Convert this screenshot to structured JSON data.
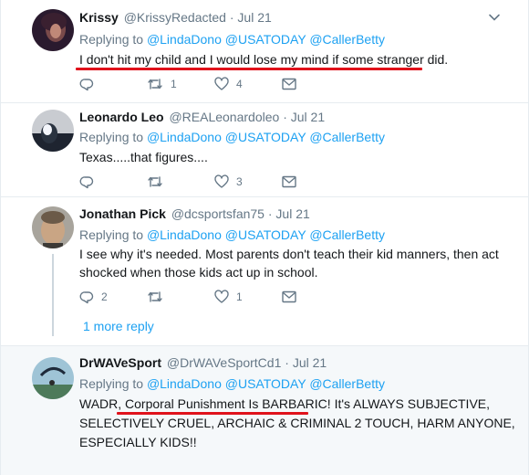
{
  "tweets": [
    {
      "name": "Krissy",
      "handle": "@KrissyRedacted",
      "dot": "·",
      "time": "Jul 21",
      "replying_prefix": "Replying to",
      "mentions": [
        "@LindaDono",
        "@USATODAY",
        "@CallerBetty"
      ],
      "text_lines": [
        "I don't hit my child and I would lose my mind if some stranger did."
      ],
      "replies": "",
      "retweets": "1",
      "likes": "4"
    },
    {
      "name": "Leonardo Leo",
      "handle": "@REALeonardoleo",
      "dot": "·",
      "time": "Jul 21",
      "replying_prefix": "Replying to",
      "mentions": [
        "@LindaDono",
        "@USATODAY",
        "@CallerBetty"
      ],
      "text_lines": [
        "Texas.....that figures...."
      ],
      "replies": "",
      "retweets": "",
      "likes": "3"
    },
    {
      "name": "Jonathan Pick",
      "handle": "@dcsportsfan75",
      "dot": "·",
      "time": "Jul 21",
      "replying_prefix": "Replying to",
      "mentions": [
        "@LindaDono",
        "@USATODAY",
        "@CallerBetty"
      ],
      "text_lines": [
        "I see why it's needed. Most parents don't teach their kid manners, then act",
        "shocked when those kids act up in school."
      ],
      "replies": "2",
      "retweets": "",
      "likes": "1",
      "more_replies": "1 more reply"
    },
    {
      "name": "DrWAVeSport",
      "handle": "@DrWAVeSportCd1",
      "dot": "·",
      "time": "Jul 21",
      "replying_prefix": "Replying to",
      "mentions": [
        "@LindaDono",
        "@USATODAY",
        "@CallerBetty"
      ],
      "text_lines": [
        "WADR, Corporal Punishment Is BARBARIC! It's ALWAYS SUBJECTIVE,",
        "SELECTIVELY CRUEL, ARCHAIC & CRIMINAL 2 TOUCH, HARM ANYONE,",
        "ESPECIALLY KIDS!!"
      ]
    }
  ],
  "icons": {
    "reply": "reply-icon",
    "retweet": "retweet-icon",
    "like": "heart-icon",
    "dm": "envelope-icon",
    "caret": "chevron-down-icon"
  },
  "colors": {
    "link": "#1da1f2",
    "muted": "#657786",
    "annotation_red": "#e0121b",
    "highlight_bg": "#f5f8fa"
  }
}
